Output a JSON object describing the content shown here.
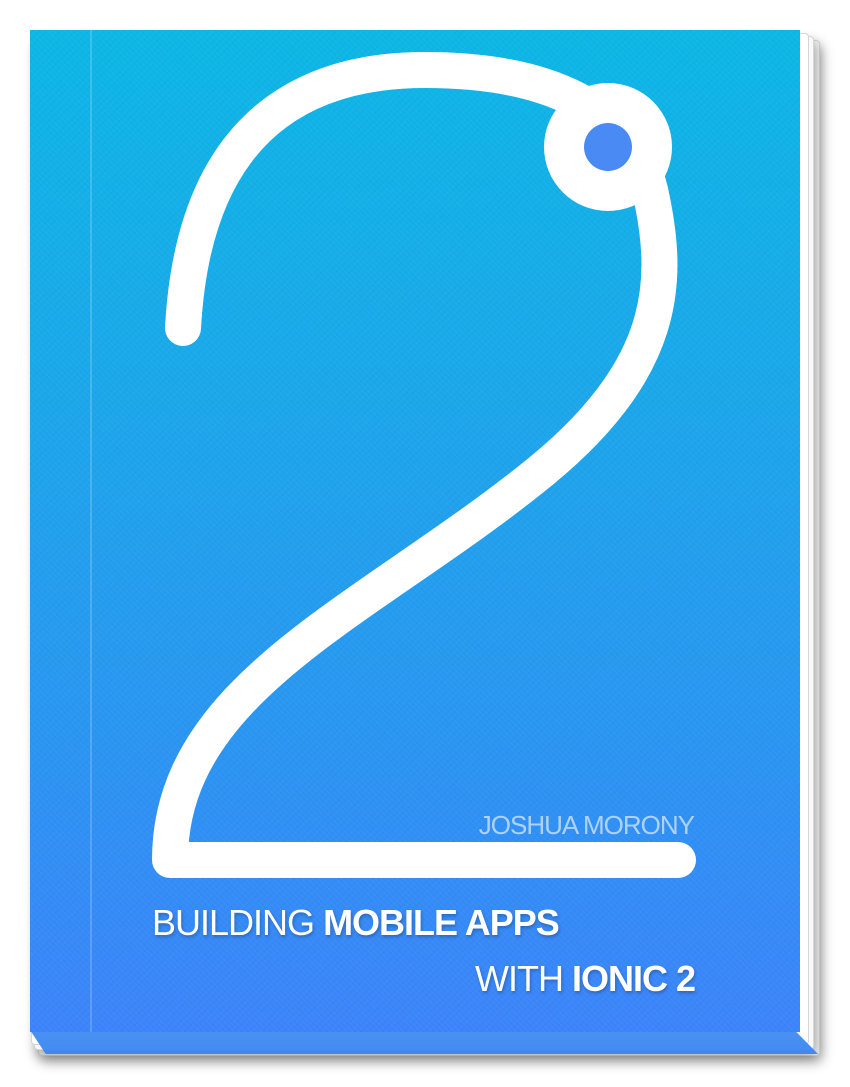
{
  "book": {
    "numeral": "2",
    "author": "JOSHUA MORONY",
    "title_line1_light": "BUILDING",
    "title_line1_bold": "MOBILE APPS",
    "title_line2_light": "WITH",
    "title_line2_bold": "IONIC 2"
  },
  "colors": {
    "gradient_top": "#0db7e6",
    "gradient_bottom": "#3d84fb",
    "numeral": "#ffffff",
    "dot": "#4a8af4"
  }
}
